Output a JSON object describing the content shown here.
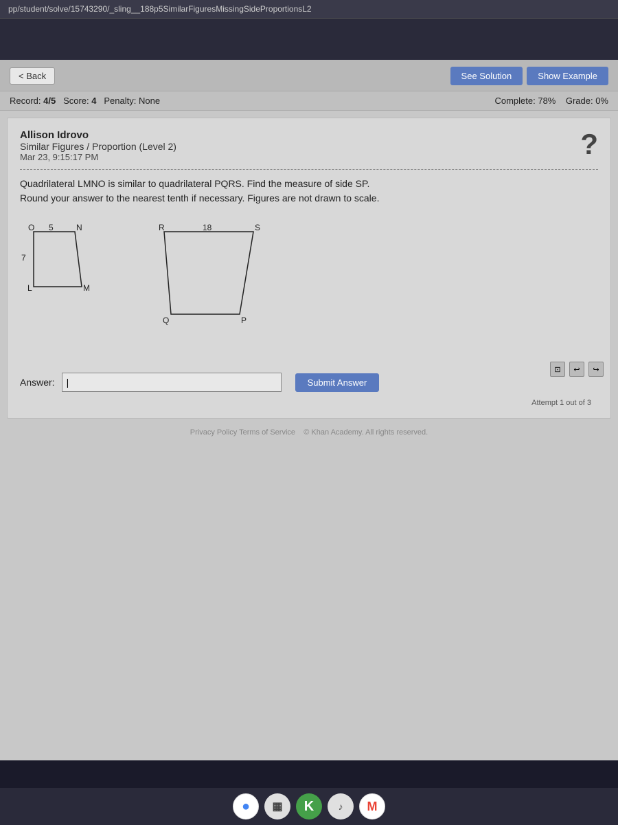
{
  "browser": {
    "url": "pp/student/solve/15743290/_sling__188p5SimilarFiguresMissingSideProportionsL2"
  },
  "header": {
    "back_label": "< Back",
    "see_solution_label": "See Solution",
    "show_example_label": "Show Example"
  },
  "record": {
    "label": "Record:",
    "record_value": "4/5",
    "score_label": "Score:",
    "score_value": "4",
    "penalty_label": "Penalty:",
    "penalty_value": "None",
    "complete_label": "Complete:",
    "complete_value": "78%",
    "grade_label": "Grade:",
    "grade_value": "0%"
  },
  "problem": {
    "student_name": "Allison Idrovo",
    "subtitle": "Similar Figures / Proportion (Level 2)",
    "date": "Mar 23, 9:15:17 PM",
    "help_icon": "?",
    "problem_text_line1": "Quadrilateral LMNO is similar to quadrilateral PQRS. Find the measure of side SP.",
    "problem_text_line2": "Round your answer to the nearest tenth if necessary. Figures are not drawn to scale.",
    "figure1": {
      "label_O": "O",
      "label_N": "N",
      "label_L": "L",
      "label_M": "M",
      "side_ON": "5",
      "side_OL": "7"
    },
    "figure2": {
      "label_R": "R",
      "label_S": "S",
      "label_Q": "Q",
      "label_P": "P",
      "side_RS": "18"
    },
    "answer": {
      "label": "Answer:",
      "placeholder": "",
      "submit_label": "Submit Answer"
    },
    "attempts": "Attempt 1 out of 3"
  },
  "footer": {
    "links": "Privacy Policy   Terms of Service",
    "copyright": "© Khan Academy. All rights reserved.",
    "icons": [
      {
        "name": "chrome-icon",
        "symbol": "●",
        "color": "#4285F4",
        "bg": "#fff"
      },
      {
        "name": "calendar-icon",
        "symbol": "▦",
        "color": "#444",
        "bg": "#e0e0e0"
      },
      {
        "name": "k-icon",
        "symbol": "K",
        "color": "#fff",
        "bg": "#45a049"
      },
      {
        "name": "notification-icon",
        "symbol": "♪",
        "color": "#444",
        "bg": "#e0e0e0"
      },
      {
        "name": "gmail-icon",
        "symbol": "M",
        "color": "#EA4335",
        "bg": "#fff"
      }
    ]
  }
}
